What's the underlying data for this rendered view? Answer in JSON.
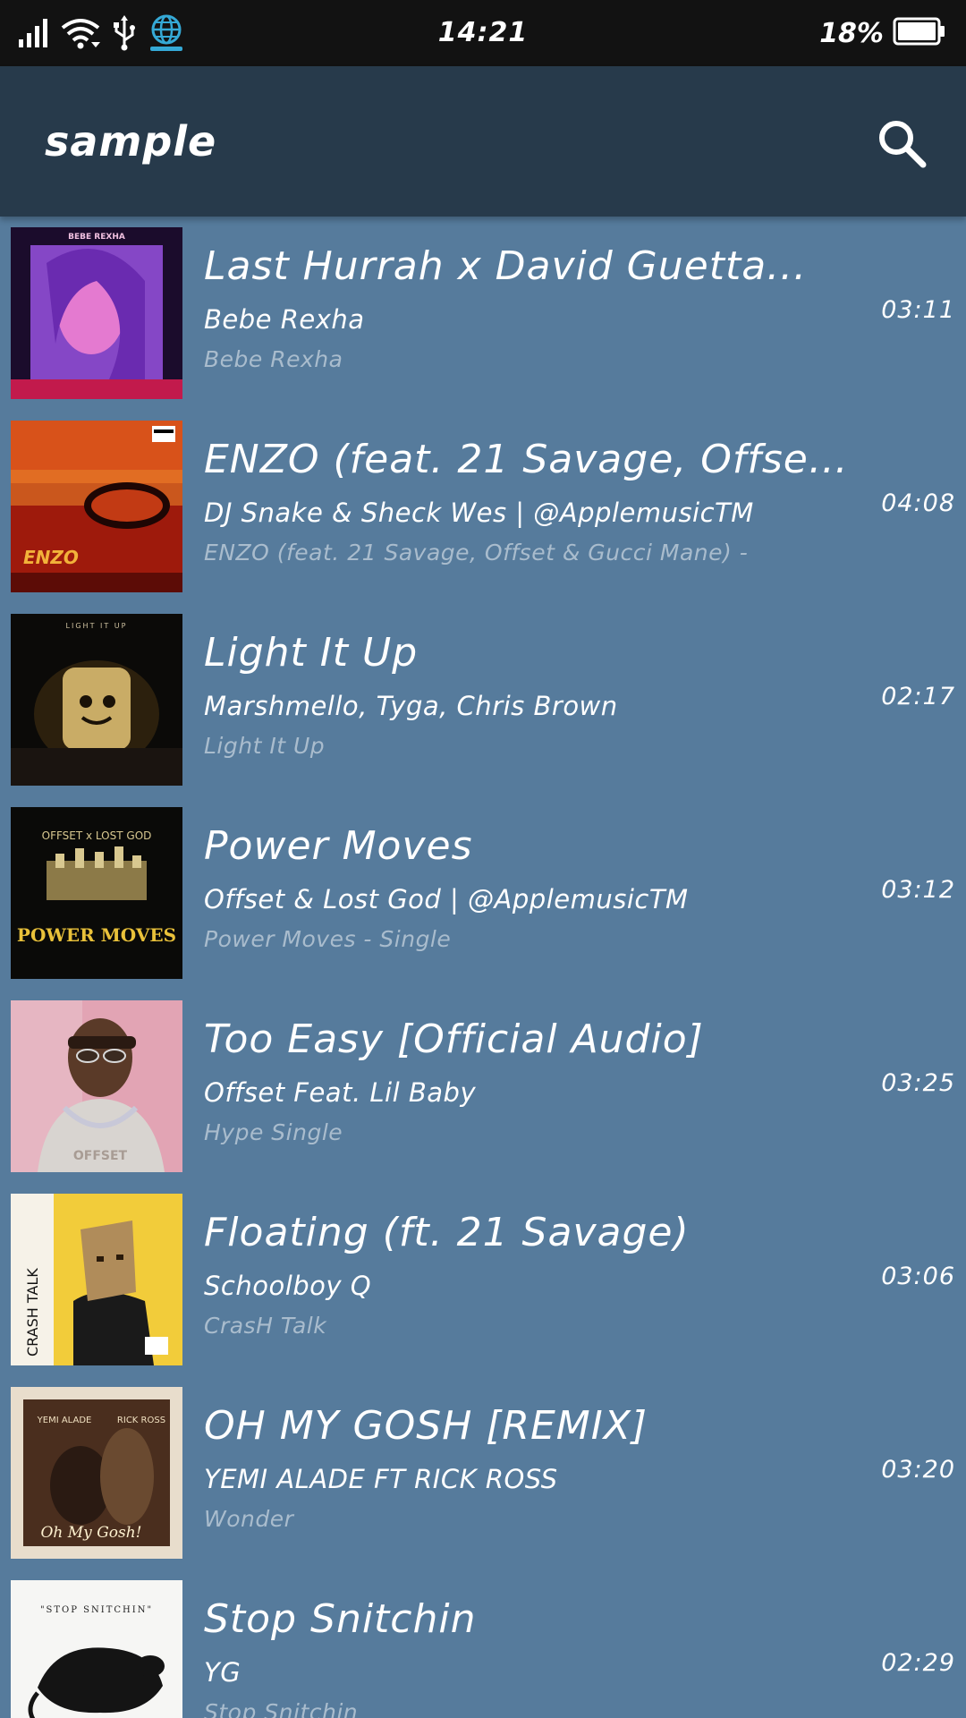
{
  "status_bar": {
    "time": "14:21",
    "battery_percent": "18%",
    "icons": [
      "signal-icon",
      "wifi-icon",
      "usb-icon",
      "vpn-globe-icon",
      "battery-icon"
    ],
    "accent_color": "#35a9d6"
  },
  "app_bar": {
    "title": "sample",
    "search_icon": "search-icon",
    "background": "#273a4b"
  },
  "list_background": "#567b9c",
  "songs": [
    {
      "title": "Last Hurrah x David Guetta...",
      "artist": "Bebe Rexha",
      "album": "Bebe Rexha",
      "duration": "03:11",
      "cover_text": "BEBE REXHA"
    },
    {
      "title": "ENZO (feat. 21 Savage, Offse...",
      "artist": "DJ Snake & Sheck Wes | @ApplemusicTM",
      "album": "ENZO (feat. 21 Savage, Offset & Gucci Mane) -",
      "duration": "04:08",
      "cover_text": "ENZO"
    },
    {
      "title": "Light It Up",
      "artist": "Marshmello, Tyga, Chris Brown",
      "album": "Light It Up",
      "duration": "02:17",
      "cover_text": "LIGHT IT UP"
    },
    {
      "title": "Power Moves",
      "artist": "Offset & Lost God | @ApplemusicTM",
      "album": "Power Moves - Single",
      "duration": "03:12",
      "cover_text": "POWER MOVES"
    },
    {
      "title": "Too Easy [Official Audio]",
      "artist": "Offset Feat. Lil Baby",
      "album": "Hype Single",
      "duration": "03:25",
      "cover_text": "OFFSET"
    },
    {
      "title": "Floating (ft. 21 Savage)",
      "artist": "Schoolboy Q",
      "album": "CrasH Talk",
      "duration": "03:06",
      "cover_text": "CRASH TALK"
    },
    {
      "title": "OH MY GOSH  [REMIX]",
      "artist": "YEMI ALADE FT RICK ROSS",
      "album": "Wonder",
      "duration": "03:20",
      "cover_text": "Oh My Gosh!"
    },
    {
      "title": "Stop Snitchin",
      "artist": "YG",
      "album": "Stop Snitchin",
      "duration": "02:29",
      "cover_text": "\"STOP SNITCHIN\""
    }
  ]
}
